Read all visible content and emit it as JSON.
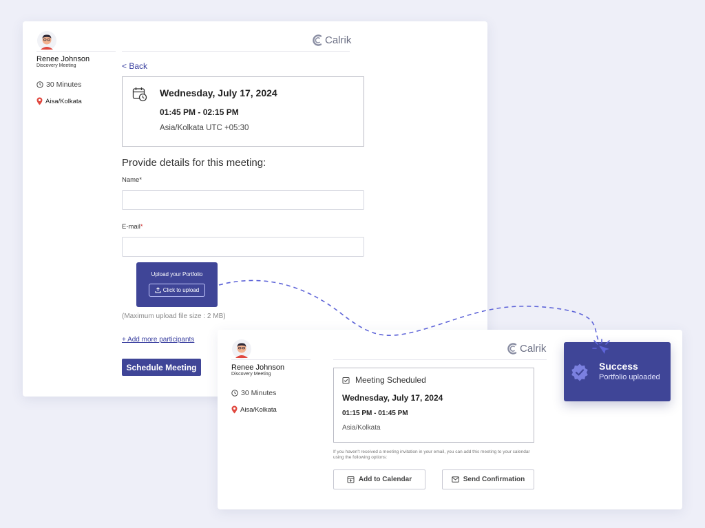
{
  "brand": {
    "name": "Calrik",
    "logo_icon": "calrik-c-logo",
    "primary_color": "#3f4597",
    "link_color": "#3a40a0",
    "error_color": "#d23030"
  },
  "booking_form": {
    "host": {
      "name": "Renee Johnson",
      "event": "Discovery Meeting",
      "duration": "30 Minutes",
      "location": "Aisa/Kolkata"
    },
    "back_label": "< Back",
    "slot": {
      "date": "Wednesday, July 17, 2024",
      "time": "01:45 PM - 02:15 PM",
      "timezone": "Asia/Kolkata UTC +05:30"
    },
    "section_title": "Provide details for this meeting:",
    "fields": {
      "name_label": "Name",
      "name_required": "*",
      "name_value": "",
      "email_label": "E-mail",
      "email_required": "*",
      "email_value": ""
    },
    "upload": {
      "title": "Upload your Portfolio",
      "button": "Click to upload",
      "max_note": "(Maximum upload file size : 2 MB)"
    },
    "add_participants": "+ Add more participants",
    "submit": "Schedule Meeting"
  },
  "confirmation": {
    "host": {
      "name": "Renee Johnson",
      "event": "Discovery Meeting",
      "duration": "30 Minutes",
      "location": "Aisa/Kolkata"
    },
    "status": "Meeting Scheduled",
    "date": "Wednesday, July 17, 2024",
    "time": "01:15 PM - 01:45 PM",
    "timezone": "Asia/Kolkata",
    "note": "If you haven't received a meeting invitation in your email, you can add this meeting to your calendar using the following options:",
    "add_calendar": "Add to Calendar",
    "send_confirmation": "Send Confirmation"
  },
  "toast": {
    "title": "Success",
    "message": "Portfolio uploaded",
    "icon": "verified-badge-icon"
  }
}
